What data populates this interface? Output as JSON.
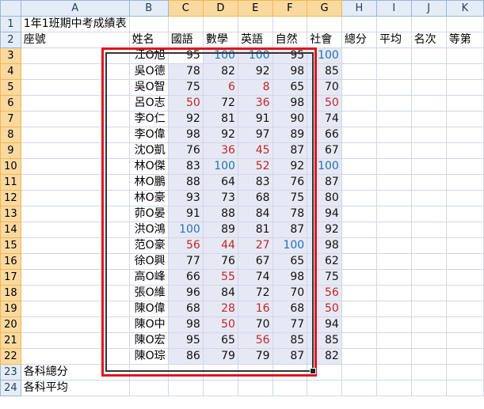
{
  "columns": [
    "A",
    "B",
    "C",
    "D",
    "E",
    "F",
    "G",
    "H",
    "I",
    "J",
    "K"
  ],
  "title": "1年1班期中考成績表",
  "headers": [
    "座號",
    "姓名",
    "國語",
    "數學",
    "英語",
    "自然",
    "社會",
    "總分",
    "平均",
    "名次",
    "等第"
  ],
  "students": [
    {
      "row": "3",
      "name": "江O旭",
      "scores": [
        95,
        100,
        100,
        95,
        100
      ]
    },
    {
      "row": "4",
      "name": "吳O德",
      "scores": [
        78,
        82,
        92,
        98,
        85
      ]
    },
    {
      "row": "5",
      "name": "吳O智",
      "scores": [
        75,
        6,
        8,
        65,
        70
      ]
    },
    {
      "row": "6",
      "name": "呂O志",
      "scores": [
        50,
        72,
        36,
        98,
        50
      ]
    },
    {
      "row": "7",
      "name": "李O仁",
      "scores": [
        92,
        81,
        91,
        90,
        74
      ]
    },
    {
      "row": "8",
      "name": "李O偉",
      "scores": [
        98,
        92,
        97,
        89,
        66
      ]
    },
    {
      "row": "9",
      "name": "沈O凱",
      "scores": [
        76,
        36,
        45,
        87,
        67
      ]
    },
    {
      "row": "10",
      "name": "林O傑",
      "scores": [
        83,
        100,
        52,
        92,
        100
      ]
    },
    {
      "row": "11",
      "name": "林O鵬",
      "scores": [
        88,
        64,
        83,
        76,
        87
      ]
    },
    {
      "row": "12",
      "name": "林O豪",
      "scores": [
        93,
        73,
        68,
        75,
        80
      ]
    },
    {
      "row": "13",
      "name": "茆O晏",
      "scores": [
        91,
        88,
        84,
        78,
        94
      ]
    },
    {
      "row": "14",
      "name": "洪O鴻",
      "scores": [
        100,
        89,
        81,
        87,
        92
      ]
    },
    {
      "row": "15",
      "name": "范O豪",
      "scores": [
        56,
        44,
        27,
        100,
        98
      ]
    },
    {
      "row": "16",
      "name": "徐O興",
      "scores": [
        77,
        76,
        67,
        65,
        62
      ]
    },
    {
      "row": "17",
      "name": "高O峰",
      "scores": [
        66,
        55,
        74,
        98,
        75
      ]
    },
    {
      "row": "18",
      "name": "張O維",
      "scores": [
        96,
        84,
        72,
        70,
        56
      ]
    },
    {
      "row": "19",
      "name": "陳O偉",
      "scores": [
        68,
        28,
        16,
        68,
        50
      ]
    },
    {
      "row": "20",
      "name": "陳O中",
      "scores": [
        98,
        50,
        70,
        77,
        94
      ]
    },
    {
      "row": "21",
      "name": "陳O宏",
      "scores": [
        95,
        65,
        56,
        85,
        85
      ]
    },
    {
      "row": "22",
      "name": "陳O琮",
      "scores": [
        86,
        79,
        79,
        87,
        82
      ]
    }
  ],
  "summary_rows": [
    {
      "row": "23",
      "label": "各科總分"
    },
    {
      "row": "24",
      "label": "各科平均"
    }
  ],
  "rows": {
    "r1": "1",
    "r2": "2"
  },
  "colors": {
    "high": "#1f72b8",
    "low": "#c0262c",
    "normal": "#111111",
    "highlight_border": "#e0161d"
  }
}
